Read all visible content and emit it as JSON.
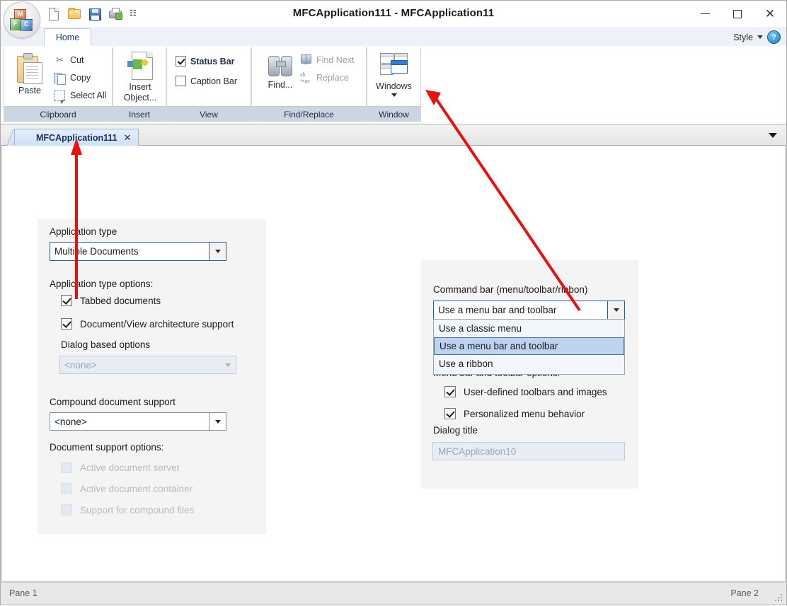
{
  "window": {
    "title": "MFCApplication111 - MFCApplication11",
    "minimize": "—",
    "maximize": "❐",
    "close": "✕"
  },
  "quick_access": {
    "items": [
      {
        "name": "new-document",
        "icon": "document-icon"
      },
      {
        "name": "open-file",
        "icon": "folder-open-icon"
      },
      {
        "name": "save",
        "icon": "floppy-disk-icon"
      },
      {
        "name": "print-preview",
        "icon": "printer-icon"
      }
    ],
    "more_label": "☷"
  },
  "ribbon": {
    "tabs": [
      {
        "label": "Home",
        "active": true
      }
    ],
    "style_label": "Style",
    "help_label": "?",
    "groups": [
      {
        "name": "Clipboard",
        "big": {
          "label": "Paste",
          "icon": "paste-icon"
        },
        "items": [
          {
            "label": "Cut",
            "icon": "scissors-icon"
          },
          {
            "label": "Copy",
            "icon": "copy-icon"
          },
          {
            "label": "Select All",
            "icon": "select-all-icon"
          }
        ]
      },
      {
        "name": "Insert",
        "big": {
          "label": "Insert Object...",
          "icon": "insert-object-icon"
        },
        "items": []
      },
      {
        "name": "View",
        "big": null,
        "items": [
          {
            "label": "Status Bar",
            "icon": "checkbox-checked-icon",
            "checked": true
          },
          {
            "label": "Caption Bar",
            "icon": "checkbox-unchecked-icon",
            "checked": false
          }
        ]
      },
      {
        "name": "Find/Replace",
        "big": {
          "label": "Find...",
          "icon": "binoculars-icon"
        },
        "items": [
          {
            "label": "Find Next",
            "icon": "find-next-icon"
          },
          {
            "label": "Replace",
            "icon": "replace-icon"
          }
        ]
      },
      {
        "name": "Window",
        "big": {
          "label": "Windows",
          "icon": "windows-tile-icon"
        },
        "items": []
      }
    ]
  },
  "mdi": {
    "tab_label": "MFCApplication111",
    "close_label": "✕",
    "overflow_icon": "chevron-down-icon"
  },
  "left_panel": {
    "app_type_label": "Application type",
    "app_type_value": "Multiple Documents",
    "app_type_options_label": "Application type options:",
    "tabbed_documents": {
      "label": "Tabbed documents",
      "checked": true
    },
    "docview_support": {
      "label": "Document/View architecture support",
      "checked": true
    },
    "dialog_based_label": "Dialog based options",
    "dialog_based_value": "<none>",
    "compound_label": "Compound document support",
    "compound_value": "<none>",
    "doc_support_label": "Document support options:",
    "doc_options": [
      {
        "label": "Active document server",
        "checked": false,
        "disabled": true
      },
      {
        "label": "Active document container",
        "checked": false,
        "disabled": true
      },
      {
        "label": "Support for compound files",
        "checked": false,
        "disabled": true
      }
    ]
  },
  "right_panel": {
    "command_bar_label": "Command bar (menu/toolbar/ribbon)",
    "command_bar_value": "Use a menu bar and toolbar",
    "dropdown_options": [
      {
        "label": "Use a classic menu",
        "selected": false
      },
      {
        "label": "Use a menu bar and toolbar",
        "selected": true
      },
      {
        "label": "Use a ribbon",
        "selected": false
      }
    ],
    "menu_options_label": "Menu bar and toolbar options:",
    "user_defined_toolbars": {
      "label": "User-defined toolbars and images",
      "checked": true
    },
    "personalized_menu": {
      "label": "Personalized menu behavior",
      "checked": true
    },
    "dialog_title_label": "Dialog title",
    "dialog_title_value": "MFCApplication10"
  },
  "status_bar": {
    "pane1": "Pane 1",
    "pane2": "Pane 2",
    "grip_icon": "resize-grip-icon"
  },
  "annotations": {
    "color": "#e8110f",
    "arrow1_name": "arrow-to-mdi-tab",
    "arrow2_name": "arrow-to-windows-group"
  }
}
